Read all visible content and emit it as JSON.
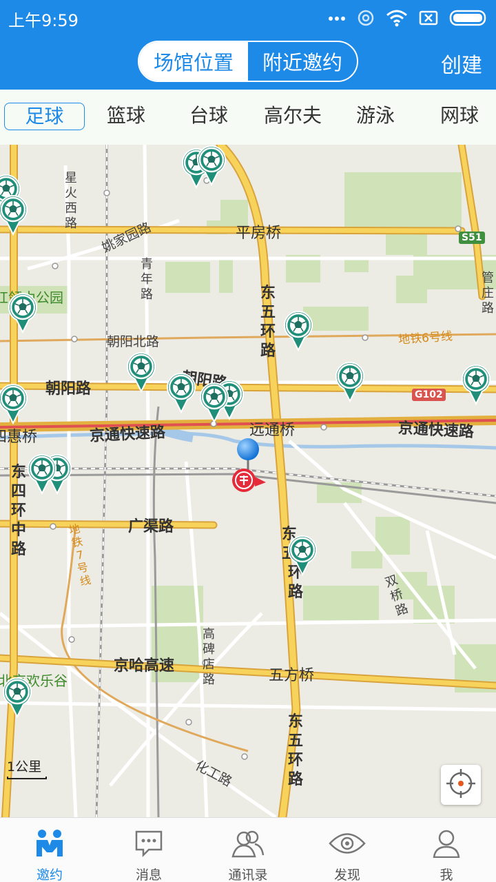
{
  "status_bar": {
    "time": "上午9:59",
    "icons": [
      "more-dots-icon",
      "hotspot-icon",
      "wifi-icon",
      "sim-card-icon",
      "battery-icon"
    ]
  },
  "header": {
    "segments": [
      "场馆位置",
      "附近邀约"
    ],
    "active_segment": "附近邀约",
    "create_label": "创建",
    "accent_color": "#1e8ae8"
  },
  "categories": {
    "items": [
      "足球",
      "篮球",
      "台球",
      "高尔夫",
      "游泳",
      "网球"
    ],
    "active": "足球"
  },
  "map": {
    "labels": {
      "xinghuo": "星火西路",
      "yaojiayuan": "姚家园路",
      "pingfangqiao": "平房桥",
      "qingnian": "青年路",
      "dongwuhuan_top": "东五环路",
      "guanzhuang": "管庄路",
      "park": "红领巾公园",
      "chaoyangbei": "朝阳北路",
      "subway6": "地铁6号线",
      "chaoyanglu_left": "朝阳路",
      "chaoyanglu_mid": "朝阳路",
      "g102": "G102",
      "s51": "S51",
      "sihuiqiao": "四惠桥",
      "jingtong_left": "京通快速路",
      "yuantongqiao": "远通桥",
      "jingtong_right": "京通快速路",
      "dongsihuan": "东四环中路",
      "guangqu": "广渠路",
      "dong_mid": "东五",
      "huanlu_mid": "环路",
      "subway7": "地铁7号线",
      "shuangqiao": "双桥路",
      "gaobeidian": "高碑店路",
      "jingha": "京哈高速",
      "wufangqiao": "五方桥",
      "happyvalley": "北京欢乐谷",
      "dongwuhuan_bottom": "东五环路",
      "huagong": "化工路"
    },
    "scale_label": "1公里"
  },
  "bottom_nav": [
    {
      "label": "邀约",
      "icon": "invite-people-icon",
      "active": true
    },
    {
      "label": "消息",
      "icon": "message-icon",
      "active": false
    },
    {
      "label": "通讯录",
      "icon": "contacts-icon",
      "active": false
    },
    {
      "label": "发现",
      "icon": "eye-icon",
      "active": false
    },
    {
      "label": "我",
      "icon": "profile-icon",
      "active": false
    }
  ]
}
